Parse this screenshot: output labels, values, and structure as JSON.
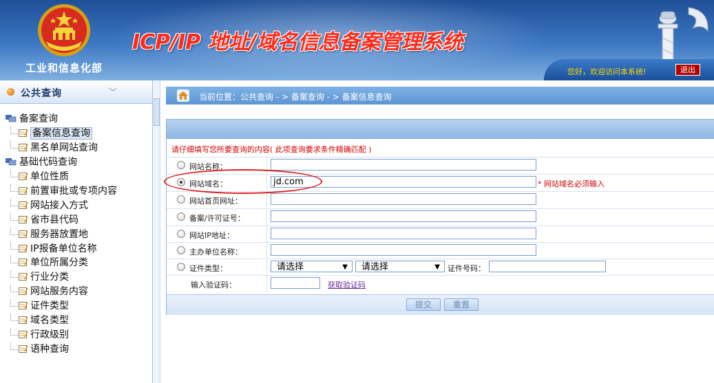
{
  "header": {
    "ministry": "工业和信息化部",
    "system_title": "ICP/IP 地址/域名信息备案管理系统",
    "greeting": "您好，欢迎访问本系统!",
    "logout": "退出"
  },
  "sidebar": {
    "title": "公共查询",
    "groups": [
      {
        "label": "备案查询",
        "items": [
          "备案信息查询",
          "黑名单网站查询"
        ]
      },
      {
        "label": "基础代码查询",
        "items": [
          "单位性质",
          "前置审批或专项内容",
          "网站接入方式",
          "省市县代码",
          "服务器放置地",
          "IP报备单位名称",
          "单位所属分类",
          "行业分类",
          "网站服务内容",
          "证件类型",
          "域名类型",
          "行政级别",
          "语种查询"
        ]
      }
    ],
    "selected_item": "备案信息查询"
  },
  "breadcrumb": "当前位置：公共查询 - > 备案查询 - > 备案信息查询",
  "form": {
    "notice": "请仔细填写您所要查询的内容( 此项查询要求条件精确匹配 )",
    "fields": [
      {
        "label": "网站名称：",
        "value": "",
        "checked": false
      },
      {
        "label": "网站域名：",
        "value": "jd.com",
        "checked": true
      },
      {
        "label": "网站首页网址：",
        "value": "",
        "checked": false
      },
      {
        "label": "备案/许可证号：",
        "value": "",
        "checked": false
      },
      {
        "label": "网站IP地址：",
        "value": "",
        "checked": false
      },
      {
        "label": "主办单位名称：",
        "value": "",
        "checked": false
      }
    ],
    "required_note": "* 网站域名必须输入",
    "cert_type_label": "证件类型：",
    "select1": "请选择",
    "select2": "请选择",
    "cert_no_label": "证件号码：",
    "captcha_label": "输入验证码：",
    "captcha_value": "",
    "captcha_link": "获取验证码",
    "submit": "提交",
    "reset": "重置"
  }
}
